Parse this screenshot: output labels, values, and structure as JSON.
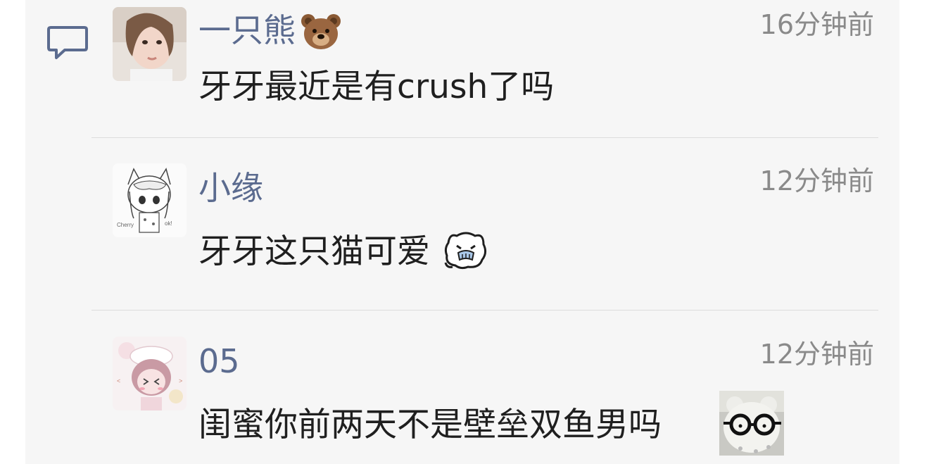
{
  "comments": [
    {
      "username": "一只熊",
      "name_emoji": "bear-face-emoji",
      "time": "16分钟前",
      "text": "牙牙最近是有crush了吗",
      "avatar": "girl-photo-avatar"
    },
    {
      "username": "小缘",
      "time": "12分钟前",
      "text": "牙牙这只猫可爱",
      "text_sticker": "crying-cat-sticker",
      "avatar": "anime-catgirl-sketch-avatar"
    },
    {
      "username": "05",
      "time": "12分钟前",
      "text": "闺蜜你前两天不是壁垒双鱼男吗",
      "text_sticker": "glasses-bear-sticker",
      "avatar": "pink-anime-girl-avatar"
    }
  ],
  "icons": {
    "reply": "comment-bubble-icon"
  }
}
